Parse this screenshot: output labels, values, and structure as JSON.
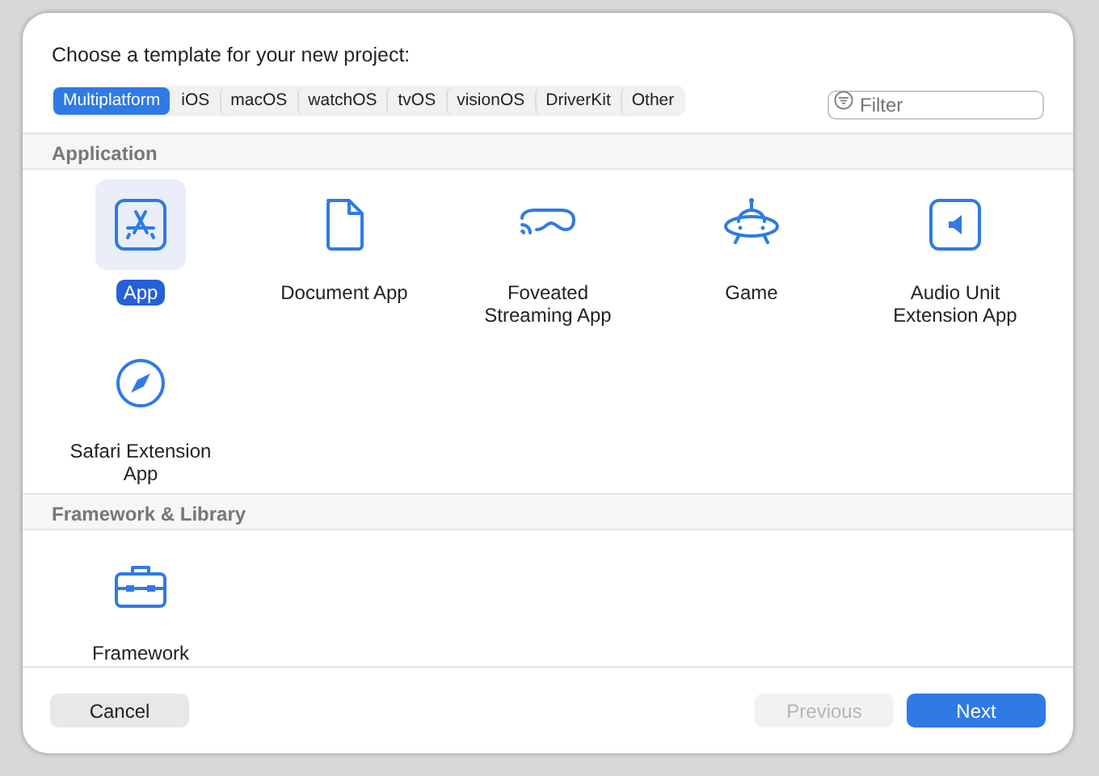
{
  "dialog": {
    "title": "Choose a template for your new project:",
    "platform_tabs": [
      {
        "label": "Multiplatform",
        "selected": true
      },
      {
        "label": "iOS",
        "selected": false
      },
      {
        "label": "macOS",
        "selected": false
      },
      {
        "label": "watchOS",
        "selected": false
      },
      {
        "label": "tvOS",
        "selected": false
      },
      {
        "label": "visionOS",
        "selected": false
      },
      {
        "label": "DriverKit",
        "selected": false
      },
      {
        "label": "Other",
        "selected": false
      }
    ],
    "filter": {
      "placeholder": "Filter"
    },
    "sections": [
      {
        "title": "Application",
        "templates": [
          {
            "label": "App",
            "kind": "appstore",
            "selected": true
          },
          {
            "label": "Document App",
            "kind": "document",
            "selected": false
          },
          {
            "label": "Foveated Streaming App",
            "kind": "headset",
            "selected": false
          },
          {
            "label": "Game",
            "kind": "ufo",
            "selected": false
          },
          {
            "label": "Audio Unit Extension App",
            "kind": "speaker",
            "selected": false
          },
          {
            "label": "Safari Extension App",
            "kind": "compass",
            "selected": false
          }
        ]
      },
      {
        "title": "Framework & Library",
        "templates": [
          {
            "label": "Framework",
            "kind": "toolbox",
            "selected": false
          }
        ]
      }
    ],
    "buttons": [
      {
        "label": "Cancel",
        "kind": "default",
        "disabled": false
      },
      {
        "label": "Previous",
        "kind": "default",
        "disabled": true
      },
      {
        "label": "Next",
        "kind": "primary",
        "disabled": false
      }
    ]
  }
}
